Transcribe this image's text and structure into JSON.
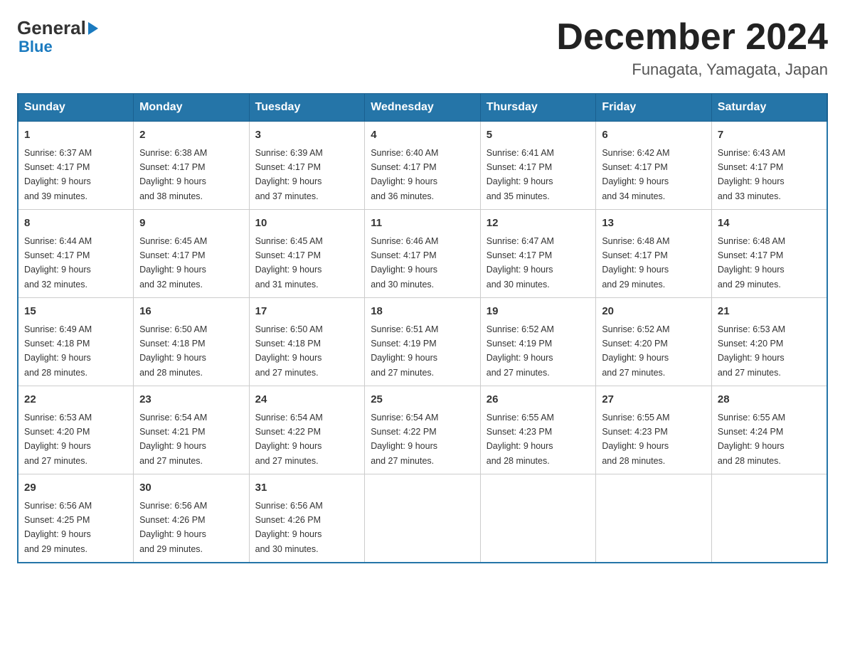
{
  "logo": {
    "line1": "General",
    "line2": "Blue"
  },
  "header": {
    "title": "December 2024",
    "subtitle": "Funagata, Yamagata, Japan"
  },
  "columns": [
    "Sunday",
    "Monday",
    "Tuesday",
    "Wednesday",
    "Thursday",
    "Friday",
    "Saturday"
  ],
  "weeks": [
    [
      {
        "day": "1",
        "sunrise": "6:37 AM",
        "sunset": "4:17 PM",
        "daylight": "9 hours and 39 minutes."
      },
      {
        "day": "2",
        "sunrise": "6:38 AM",
        "sunset": "4:17 PM",
        "daylight": "9 hours and 38 minutes."
      },
      {
        "day": "3",
        "sunrise": "6:39 AM",
        "sunset": "4:17 PM",
        "daylight": "9 hours and 37 minutes."
      },
      {
        "day": "4",
        "sunrise": "6:40 AM",
        "sunset": "4:17 PM",
        "daylight": "9 hours and 36 minutes."
      },
      {
        "day": "5",
        "sunrise": "6:41 AM",
        "sunset": "4:17 PM",
        "daylight": "9 hours and 35 minutes."
      },
      {
        "day": "6",
        "sunrise": "6:42 AM",
        "sunset": "4:17 PM",
        "daylight": "9 hours and 34 minutes."
      },
      {
        "day": "7",
        "sunrise": "6:43 AM",
        "sunset": "4:17 PM",
        "daylight": "9 hours and 33 minutes."
      }
    ],
    [
      {
        "day": "8",
        "sunrise": "6:44 AM",
        "sunset": "4:17 PM",
        "daylight": "9 hours and 32 minutes."
      },
      {
        "day": "9",
        "sunrise": "6:45 AM",
        "sunset": "4:17 PM",
        "daylight": "9 hours and 32 minutes."
      },
      {
        "day": "10",
        "sunrise": "6:45 AM",
        "sunset": "4:17 PM",
        "daylight": "9 hours and 31 minutes."
      },
      {
        "day": "11",
        "sunrise": "6:46 AM",
        "sunset": "4:17 PM",
        "daylight": "9 hours and 30 minutes."
      },
      {
        "day": "12",
        "sunrise": "6:47 AM",
        "sunset": "4:17 PM",
        "daylight": "9 hours and 30 minutes."
      },
      {
        "day": "13",
        "sunrise": "6:48 AM",
        "sunset": "4:17 PM",
        "daylight": "9 hours and 29 minutes."
      },
      {
        "day": "14",
        "sunrise": "6:48 AM",
        "sunset": "4:17 PM",
        "daylight": "9 hours and 29 minutes."
      }
    ],
    [
      {
        "day": "15",
        "sunrise": "6:49 AM",
        "sunset": "4:18 PM",
        "daylight": "9 hours and 28 minutes."
      },
      {
        "day": "16",
        "sunrise": "6:50 AM",
        "sunset": "4:18 PM",
        "daylight": "9 hours and 28 minutes."
      },
      {
        "day": "17",
        "sunrise": "6:50 AM",
        "sunset": "4:18 PM",
        "daylight": "9 hours and 27 minutes."
      },
      {
        "day": "18",
        "sunrise": "6:51 AM",
        "sunset": "4:19 PM",
        "daylight": "9 hours and 27 minutes."
      },
      {
        "day": "19",
        "sunrise": "6:52 AM",
        "sunset": "4:19 PM",
        "daylight": "9 hours and 27 minutes."
      },
      {
        "day": "20",
        "sunrise": "6:52 AM",
        "sunset": "4:20 PM",
        "daylight": "9 hours and 27 minutes."
      },
      {
        "day": "21",
        "sunrise": "6:53 AM",
        "sunset": "4:20 PM",
        "daylight": "9 hours and 27 minutes."
      }
    ],
    [
      {
        "day": "22",
        "sunrise": "6:53 AM",
        "sunset": "4:20 PM",
        "daylight": "9 hours and 27 minutes."
      },
      {
        "day": "23",
        "sunrise": "6:54 AM",
        "sunset": "4:21 PM",
        "daylight": "9 hours and 27 minutes."
      },
      {
        "day": "24",
        "sunrise": "6:54 AM",
        "sunset": "4:22 PM",
        "daylight": "9 hours and 27 minutes."
      },
      {
        "day": "25",
        "sunrise": "6:54 AM",
        "sunset": "4:22 PM",
        "daylight": "9 hours and 27 minutes."
      },
      {
        "day": "26",
        "sunrise": "6:55 AM",
        "sunset": "4:23 PM",
        "daylight": "9 hours and 28 minutes."
      },
      {
        "day": "27",
        "sunrise": "6:55 AM",
        "sunset": "4:23 PM",
        "daylight": "9 hours and 28 minutes."
      },
      {
        "day": "28",
        "sunrise": "6:55 AM",
        "sunset": "4:24 PM",
        "daylight": "9 hours and 28 minutes."
      }
    ],
    [
      {
        "day": "29",
        "sunrise": "6:56 AM",
        "sunset": "4:25 PM",
        "daylight": "9 hours and 29 minutes."
      },
      {
        "day": "30",
        "sunrise": "6:56 AM",
        "sunset": "4:26 PM",
        "daylight": "9 hours and 29 minutes."
      },
      {
        "day": "31",
        "sunrise": "6:56 AM",
        "sunset": "4:26 PM",
        "daylight": "9 hours and 30 minutes."
      },
      null,
      null,
      null,
      null
    ]
  ],
  "labels": {
    "sunrise": "Sunrise:",
    "sunset": "Sunset:",
    "daylight": "Daylight:"
  }
}
